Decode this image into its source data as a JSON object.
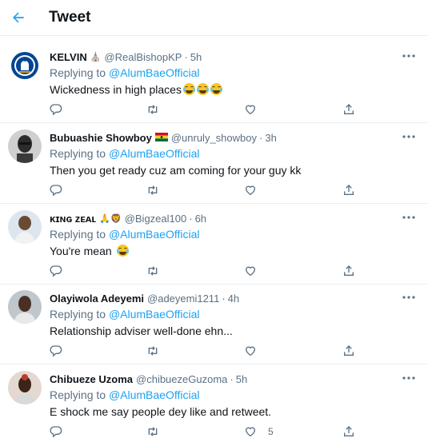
{
  "header": {
    "title": "Tweet"
  },
  "tweets": [
    {
      "name": "KELVIN",
      "badge": "⛪",
      "handle": "@RealBishopKP",
      "time": "5h",
      "reply_prefix": "Replying to",
      "reply_to": "@AlumBaeOfficial",
      "text": "Wickedness in high places",
      "emoji_count": 3,
      "likes": "",
      "avatar_icon": "chelsea-crest"
    },
    {
      "name": "Bubuashie Showboy",
      "badge": "🇬🇭",
      "handle": "@unruly_showboy",
      "time": "3h",
      "reply_prefix": "Replying to",
      "reply_to": "@AlumBaeOfficial",
      "text": "Then you get ready cuz am coming for your guy kk",
      "emoji_count": 0,
      "likes": "",
      "avatar_icon": "profile-photo"
    },
    {
      "name": "ᴋɪɴɢ ᴢᴇᴀʟ",
      "badge": "🙏🦁",
      "handle": "@Bigzeal100",
      "time": "6h",
      "reply_prefix": "Replying to",
      "reply_to": "@AlumBaeOfficial",
      "text": "You're mean",
      "emoji_count": 1,
      "likes": "",
      "avatar_icon": "profile-photo"
    },
    {
      "name": "Olayiwola Adeyemi",
      "badge": "",
      "handle": "@adeyemi1211",
      "time": "4h",
      "reply_prefix": "Replying to",
      "reply_to": "@AlumBaeOfficial",
      "text": "Relationship adviser well-done ehn...",
      "emoji_count": 0,
      "likes": "",
      "avatar_icon": "profile-photo"
    },
    {
      "name": "Chibueze Uzoma",
      "badge": "",
      "handle": "@chibuezeGuzoma",
      "time": "5h",
      "reply_prefix": "Replying to",
      "reply_to": "@AlumBaeOfficial",
      "text": "E shock me say people dey like and retweet.",
      "emoji_count": 0,
      "likes": "5",
      "avatar_icon": "profile-photo"
    }
  ],
  "colors": {
    "accent": "#1da1f2",
    "secondary_text": "#5b7083",
    "divider": "#ebeef0"
  }
}
